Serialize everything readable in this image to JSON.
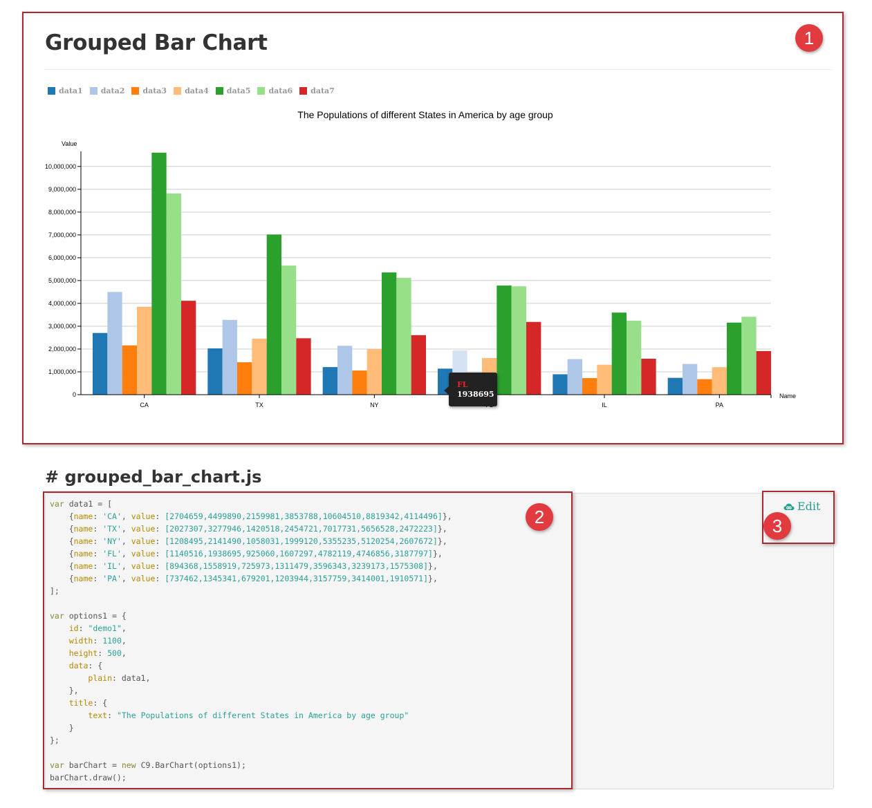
{
  "page": {
    "title": "Grouped Bar Chart",
    "section_heading": "# grouped_bar_chart.js"
  },
  "annotations": [
    {
      "label": "1"
    },
    {
      "label": "2"
    },
    {
      "label": "3"
    }
  ],
  "legend": {
    "items": [
      {
        "label": "data1",
        "color": "#1f77b4"
      },
      {
        "label": "data2",
        "color": "#aec7e8"
      },
      {
        "label": "data3",
        "color": "#ff7f0e"
      },
      {
        "label": "data4",
        "color": "#ffbb78"
      },
      {
        "label": "data5",
        "color": "#2ca02c"
      },
      {
        "label": "data6",
        "color": "#98df8a"
      },
      {
        "label": "data7",
        "color": "#d62728"
      }
    ]
  },
  "chart_data": {
    "type": "bar",
    "title": "The Populations of different States in America by age group",
    "xlabel": "Name",
    "ylabel": "Value",
    "ylim": [
      0,
      10600000
    ],
    "y_ticks": [
      "0",
      "1,000,000",
      "2,000,000",
      "3,000,000",
      "4,000,000",
      "5,000,000",
      "6,000,000",
      "7,000,000",
      "8,000,000",
      "9,000,000",
      "10,000,000"
    ],
    "categories": [
      "CA",
      "TX",
      "NY",
      "FL",
      "IL",
      "PA"
    ],
    "grid": true,
    "legend_position": "top-left",
    "series": [
      {
        "name": "data1",
        "color": "#1f77b4",
        "values": [
          2704659,
          2027307,
          1208495,
          1140516,
          894368,
          737462
        ]
      },
      {
        "name": "data2",
        "color": "#aec7e8",
        "values": [
          4499890,
          3277946,
          2141490,
          1938695,
          1558919,
          1345341
        ]
      },
      {
        "name": "data3",
        "color": "#ff7f0e",
        "values": [
          2159981,
          1420518,
          1058031,
          925060,
          725973,
          679201
        ]
      },
      {
        "name": "data4",
        "color": "#ffbb78",
        "values": [
          3853788,
          2454721,
          1999120,
          1607297,
          1311479,
          1203944
        ]
      },
      {
        "name": "data5",
        "color": "#2ca02c",
        "values": [
          10604510,
          7017731,
          5355235,
          4782119,
          3596343,
          3157759
        ]
      },
      {
        "name": "data6",
        "color": "#98df8a",
        "values": [
          8819342,
          5656528,
          5120254,
          4746856,
          3239173,
          3414001
        ]
      },
      {
        "name": "data7",
        "color": "#d62728",
        "values": [
          4114496,
          2472223,
          2607672,
          3187797,
          1575308,
          1910571
        ]
      }
    ],
    "highlight": {
      "category": "FL",
      "series": "data2"
    }
  },
  "tooltip": {
    "name": "FL",
    "value": "1938695"
  },
  "code": {
    "edit_label": "Edit",
    "states": [
      {
        "name": "'CA'",
        "values": "[2704659,4499890,2159981,3853788,10604510,8819342,4114496]"
      },
      {
        "name": "'TX'",
        "values": "[2027307,3277946,1420518,2454721,7017731,5656528,2472223]"
      },
      {
        "name": "'NY'",
        "values": "[1208495,2141490,1058031,1999120,5355235,5120254,2607672]"
      },
      {
        "name": "'FL'",
        "values": "[1140516,1938695,925060,1607297,4782119,4746856,3187797]"
      },
      {
        "name": "'IL'",
        "values": "[894368,1558919,725973,1311479,3596343,3239173,1575308]"
      },
      {
        "name": "'PA'",
        "values": "[737462,1345341,679201,1203944,3157759,3414001,1910571]"
      }
    ],
    "id_value": "\"demo1\"",
    "width_value": "1100",
    "height_value": "500",
    "title_text": "\"The Populations of different States in America by age group\""
  }
}
